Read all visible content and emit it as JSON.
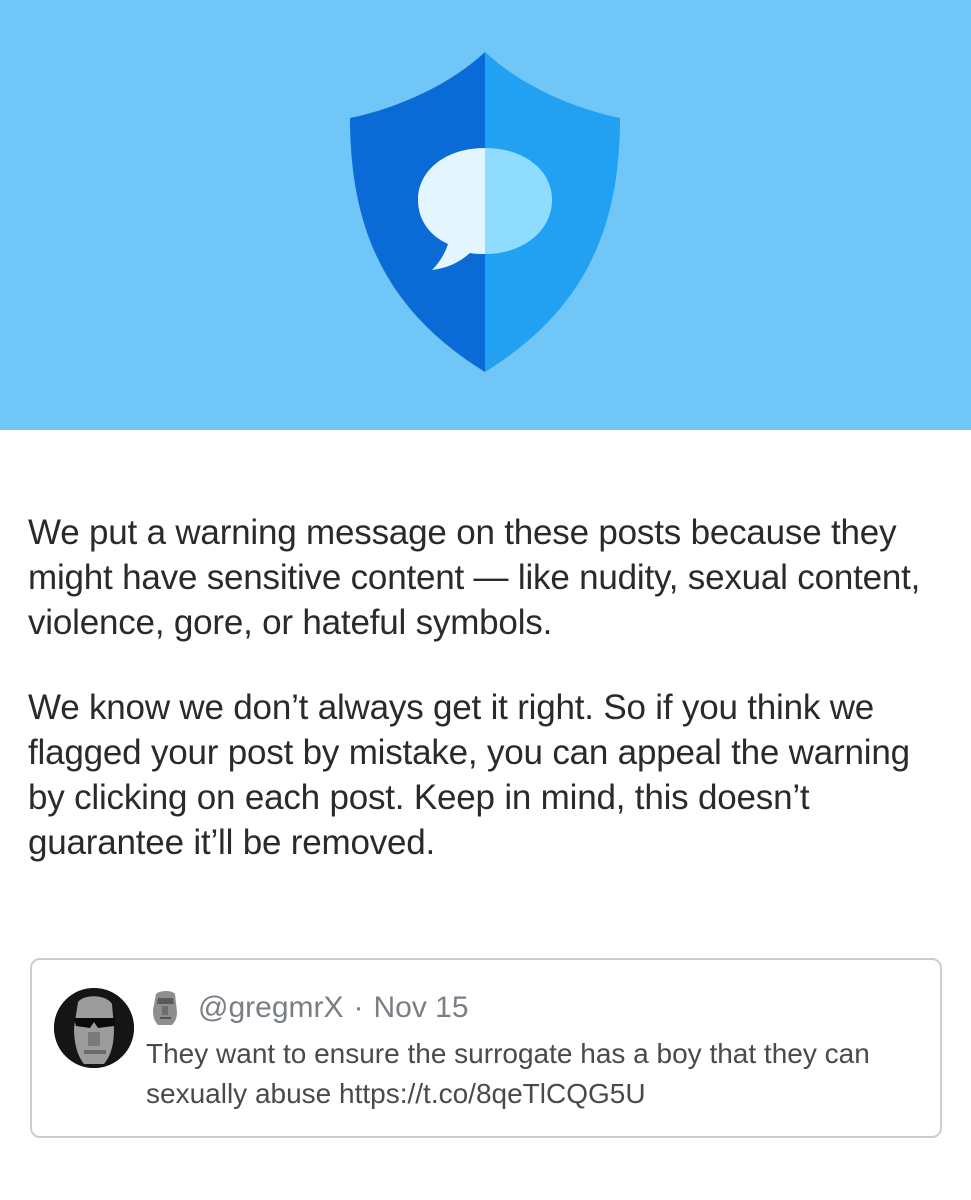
{
  "hero": {
    "background_color": "#6fc6f7",
    "icon": "shield-chat-icon",
    "shield_left_color": "#0a6bd6",
    "shield_right_color": "#22a0f2"
  },
  "body": {
    "paragraph_1": "We put a warning message on these posts because they might have sensitive content — like nudity, sexual content, violence, gore, or hateful symbols.",
    "paragraph_2": "We know we don’t always get it right. So if you think we flagged your post by mistake, you can appeal the warning by clicking on each post. Keep in mind, this doesn’t guarantee it’ll be removed."
  },
  "tweet": {
    "avatar_icon": "avatar-sunglasses-moai",
    "emoji_icon": "moai-icon",
    "handle": "@gregmrX",
    "separator": "·",
    "date": "Nov 15",
    "text": "They want to ensure the surrogate has a boy that they can sexually abuse https://t.co/8qeTlCQG5U"
  }
}
